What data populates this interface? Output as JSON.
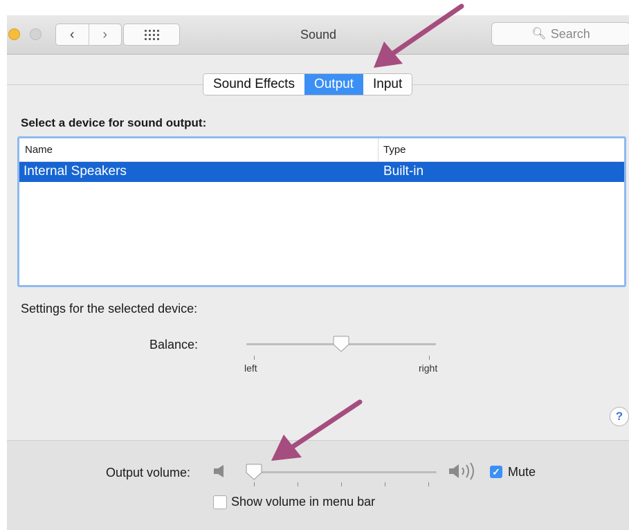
{
  "window": {
    "title": "Sound"
  },
  "search": {
    "placeholder": "Search",
    "icon": "search-icon"
  },
  "tabs": [
    {
      "label": "Sound Effects",
      "active": false
    },
    {
      "label": "Output",
      "active": true
    },
    {
      "label": "Input",
      "active": false
    }
  ],
  "output": {
    "heading": "Select a device for sound output:",
    "columns": [
      "Name",
      "Type"
    ],
    "rows": [
      {
        "name": "Internal Speakers",
        "type": "Built-in",
        "selected": true
      }
    ]
  },
  "settings": {
    "heading": "Settings for the selected device:",
    "balance_label": "Balance:",
    "balance_left": "left",
    "balance_right": "right",
    "balance_value": 0.5
  },
  "help": {
    "label": "?"
  },
  "volume": {
    "label": "Output volume:",
    "value": 0.0,
    "mute_label": "Mute",
    "mute_checked": true,
    "menubar_label": "Show volume in menu bar",
    "menubar_checked": false
  },
  "colors": {
    "accent": "#3b8ff5",
    "selection": "#1765d3",
    "annotation_arrow": "#a54d7e"
  }
}
